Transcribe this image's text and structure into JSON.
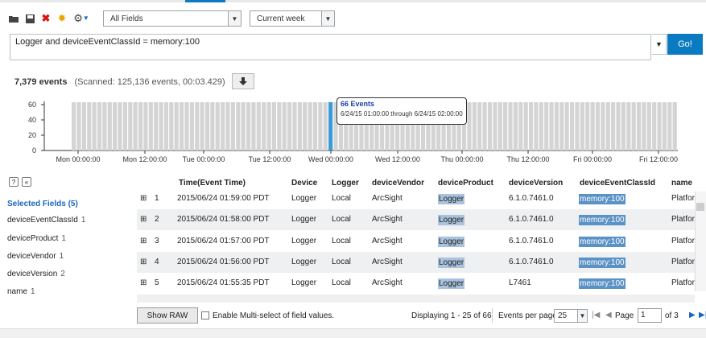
{
  "toolbar": {
    "fields_select": "All Fields",
    "time_select": "Current week"
  },
  "query": {
    "text": "Logger and deviceEventClassId = memory:100",
    "go_label": "Go!"
  },
  "summary": {
    "events": "7,379 events",
    "scanned": "(Scanned: 125,136 events,  00:03.429)"
  },
  "histogram": {
    "y_ticks": [
      "60",
      "40",
      "20",
      "0"
    ],
    "x_ticks": [
      "Mon 00:00:00",
      "Mon 12:00:00",
      "Tue 00:00:00",
      "Tue 12:00:00",
      "Wed 00:00:00",
      "Wed 12:00:00",
      "Thu 00:00:00",
      "Thu 12:00:00",
      "Fri 00:00:00",
      "Fri 12:00:00"
    ],
    "tooltip_title": "66 Events",
    "tooltip_range": "6/24/15 01:00:00 through 6/24/15 02:00:00",
    "colors": {
      "bar": "#d4d4d4",
      "highlight": "#3b9ad8"
    }
  },
  "sidebar": {
    "title": "Selected Fields (5)",
    "items": [
      {
        "name": "deviceEventClassId",
        "count": "1"
      },
      {
        "name": "deviceProduct",
        "count": "1"
      },
      {
        "name": "deviceVendor",
        "count": "1"
      },
      {
        "name": "deviceVersion",
        "count": "2"
      },
      {
        "name": "name",
        "count": "1"
      }
    ]
  },
  "table": {
    "columns": [
      "Time(Event Time)",
      "Device",
      "Logger",
      "deviceVendor",
      "deviceProduct",
      "deviceVersion",
      "deviceEventClassId",
      "name"
    ],
    "rows": [
      {
        "num": "1",
        "time": "2015/06/24 01:59:00 PDT",
        "device": "Logger",
        "logger": "Local",
        "vendor": "ArcSight",
        "product": "Logger",
        "version": "6.1.0.7461.0",
        "classid": "memory:100",
        "name": "Platfor"
      },
      {
        "num": "2",
        "time": "2015/06/24 01:58:00 PDT",
        "device": "Logger",
        "logger": "Local",
        "vendor": "ArcSight",
        "product": "Logger",
        "version": "6.1.0.7461.0",
        "classid": "memory:100",
        "name": "Platfor"
      },
      {
        "num": "3",
        "time": "2015/06/24 01:57:00 PDT",
        "device": "Logger",
        "logger": "Local",
        "vendor": "ArcSight",
        "product": "Logger",
        "version": "6.1.0.7461.0",
        "classid": "memory:100",
        "name": "Platfor"
      },
      {
        "num": "4",
        "time": "2015/06/24 01:56:00 PDT",
        "device": "Logger",
        "logger": "Local",
        "vendor": "ArcSight",
        "product": "Logger",
        "version": "6.1.0.7461.0",
        "classid": "memory:100",
        "name": "Platfor"
      },
      {
        "num": "5",
        "time": "2015/06/24 01:55:35 PDT",
        "device": "Logger",
        "logger": "Local",
        "vendor": "ArcSight",
        "product": "Logger",
        "version": "L7461",
        "classid": "memory:100",
        "name": "Platfor"
      }
    ]
  },
  "footer": {
    "show_raw": "Show RAW",
    "multiselect": "Enable Multi-select of field values.",
    "displaying": "Displaying 1 - 25 of 66",
    "per_page_label": "Events per page",
    "per_page": "25",
    "page_label": "Page",
    "page_value": "1",
    "of_pages": "of 3"
  }
}
